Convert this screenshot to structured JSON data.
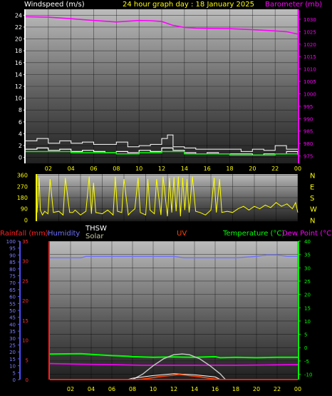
{
  "header": {
    "wind_label": "Windspeed (m/s)",
    "title": "24 hour graph day : 18 January 2025",
    "baro_label": "Barometer (mb)"
  },
  "bottom_header": {
    "rain_label": "Rainfall (mm)",
    "humidity_label": "Humidity",
    "thsw_label": "THSW",
    "solar_label": "Solar",
    "uv_label": "UV",
    "temp_label": "Temperature (°C)",
    "dew_label": "Dew Point (°C)"
  },
  "colors": {
    "wind": "#ffffff",
    "gust": "#ffffff",
    "wind_avg": "#00ff00",
    "barometer": "#ff00ff",
    "direction": "#ffff00",
    "rain": "#ff2020",
    "humidity": "#7070ff",
    "thsw": "#ffffff",
    "solar": "#c8c8c8",
    "uv": "#ff4400",
    "temperature": "#00ff00",
    "dewpoint": "#ff00ff",
    "axis_x": "#ffff00"
  },
  "chart_data": [
    {
      "type": "line",
      "name": "wind-barometer",
      "x_ticks": [
        "02",
        "04",
        "06",
        "08",
        "10",
        "12",
        "14",
        "16",
        "18",
        "20",
        "22",
        "00"
      ],
      "ylim_left": [
        -1,
        25
      ],
      "y_ticks_left": [
        0,
        2,
        4,
        6,
        8,
        10,
        12,
        14,
        16,
        18,
        20,
        22,
        24
      ],
      "ylim_right": [
        972,
        1034
      ],
      "y_ticks_right": [
        975,
        980,
        985,
        990,
        995,
        1000,
        1005,
        1010,
        1015,
        1020,
        1025,
        1030
      ],
      "series": [
        {
          "name": "Barometer",
          "axis": "right",
          "x": [
            0,
            2,
            4,
            6,
            7,
            8,
            9,
            10,
            11,
            12,
            13,
            14,
            15,
            16,
            18,
            20,
            22,
            23,
            24
          ],
          "values": [
            1031,
            1030.8,
            1030.2,
            1029.5,
            1029.2,
            1028.9,
            1029.2,
            1029.5,
            1029.4,
            1029.1,
            1027.5,
            1026.7,
            1026.4,
            1026.3,
            1026.2,
            1025.8,
            1025.3,
            1025,
            1024
          ]
        },
        {
          "name": "Gust",
          "axis": "left",
          "x": [
            0,
            1,
            2,
            3,
            4,
            5,
            6,
            7,
            8,
            9,
            10,
            11,
            12,
            12.5,
            13,
            14,
            15,
            16,
            17,
            18,
            19,
            20,
            21,
            22,
            23,
            24
          ],
          "values": [
            2.8,
            3.2,
            2.4,
            2.8,
            2.4,
            2.6,
            2.2,
            2.2,
            2.6,
            1.8,
            2.0,
            2.2,
            3.2,
            3.8,
            1.8,
            1.6,
            1.4,
            1.4,
            1.4,
            1.4,
            1.0,
            1.4,
            1.2,
            2.0,
            1.4,
            1.4
          ]
        },
        {
          "name": "Wind",
          "axis": "left",
          "x": [
            0,
            1,
            2,
            3,
            4,
            5,
            6,
            7,
            8,
            9,
            10,
            11,
            12,
            13,
            14,
            15,
            16,
            17,
            18,
            19,
            20,
            21,
            22,
            23,
            24
          ],
          "values": [
            1.4,
            1.6,
            1.2,
            1.4,
            1.0,
            1.2,
            1.0,
            0.8,
            1.0,
            0.8,
            1.2,
            1.0,
            1.6,
            1.2,
            0.8,
            0.6,
            0.8,
            0.6,
            0.6,
            0.6,
            0.4,
            0.6,
            0.6,
            1.0,
            0.6
          ]
        },
        {
          "name": "Wind Average",
          "axis": "left",
          "x": [
            0,
            2,
            4,
            6,
            8,
            10,
            12,
            14,
            16,
            18,
            20,
            22,
            24
          ],
          "values": [
            1.0,
            1.0,
            0.8,
            0.8,
            0.6,
            0.8,
            1.0,
            0.6,
            0.6,
            0.4,
            0.4,
            0.6,
            0.4
          ]
        }
      ]
    },
    {
      "type": "line",
      "name": "wind-direction",
      "x_ticks": [
        "02",
        "04",
        "06",
        "08",
        "10",
        "12",
        "14",
        "16",
        "18",
        "20",
        "22",
        "00"
      ],
      "ylim": [
        -10,
        370
      ],
      "y_ticks": [
        0,
        90,
        180,
        270,
        360
      ],
      "compass": [
        "N",
        "W",
        "S",
        "E",
        "N"
      ],
      "series": [
        {
          "name": "Direction",
          "x": [
            0,
            0.2,
            0.3,
            0.5,
            0.7,
            1,
            1.2,
            1.5,
            2,
            2.4,
            2.6,
            3,
            3.3,
            3.5,
            4,
            4.5,
            4.8,
            5,
            5.2,
            5.4,
            6,
            6.5,
            7,
            7.2,
            7.4,
            7.8,
            8,
            8.4,
            8.6,
            9,
            9.3,
            9.5,
            10,
            10.2,
            10.4,
            10.8,
            11,
            11.4,
            11.6,
            12,
            12.2,
            12.4,
            12.6,
            12.8,
            13,
            13.2,
            13.4,
            13.6,
            13.8,
            14,
            14.3,
            14.6,
            15,
            15.5,
            16,
            16.3,
            16.5,
            16.8,
            17,
            17.5,
            18,
            18.5,
            19,
            19.5,
            20,
            20.5,
            21,
            21.5,
            22,
            22.5,
            23,
            23.5,
            23.8,
            24
          ],
          "values": [
            60,
            340,
            80,
            40,
            70,
            50,
            330,
            60,
            70,
            40,
            340,
            60,
            60,
            80,
            40,
            70,
            350,
            50,
            300,
            60,
            50,
            80,
            40,
            350,
            70,
            60,
            330,
            40,
            60,
            90,
            340,
            60,
            40,
            330,
            80,
            50,
            330,
            40,
            350,
            30,
            340,
            60,
            345,
            70,
            350,
            30,
            340,
            80,
            330,
            60,
            350,
            70,
            60,
            40,
            80,
            340,
            60,
            330,
            60,
            70,
            60,
            90,
            110,
            80,
            110,
            90,
            120,
            100,
            140,
            110,
            130,
            90,
            140,
            60
          ]
        }
      ]
    },
    {
      "type": "line",
      "name": "temperature-humidity-solar",
      "x_ticks": [
        "02",
        "04",
        "06",
        "08",
        "10",
        "12",
        "14",
        "16",
        "18",
        "20",
        "22",
        "00"
      ],
      "ylim_humidity": [
        0,
        100
      ],
      "y_ticks_humidity": [
        0,
        5,
        10,
        15,
        20,
        25,
        30,
        35,
        40,
        45,
        50,
        55,
        60,
        65,
        70,
        75,
        80,
        85,
        90,
        95,
        100
      ],
      "ylim_rain": [
        0,
        35
      ],
      "y_ticks_rain": [
        0,
        5,
        10,
        15,
        20,
        25,
        30,
        35
      ],
      "ylim_temp": [
        -12,
        40
      ],
      "y_ticks_temp": [
        -10,
        -5,
        0,
        5,
        10,
        15,
        20,
        25,
        30,
        35,
        40
      ],
      "series": [
        {
          "name": "Humidity",
          "axis": "humidity",
          "x": [
            0,
            3,
            3.5,
            6,
            9,
            12,
            13,
            15,
            18,
            20,
            21,
            22,
            23,
            24
          ],
          "values": [
            88,
            88,
            89,
            89,
            89,
            89,
            88,
            88,
            88,
            89,
            90,
            90,
            89,
            89
          ]
        },
        {
          "name": "Temperature",
          "axis": "temp",
          "x": [
            0,
            3,
            6,
            7.5,
            8,
            10,
            12,
            14,
            16,
            16.5,
            18,
            20,
            22,
            24
          ],
          "values": [
            -2.4,
            -2.3,
            -3.0,
            -3.2,
            -3.4,
            -3.6,
            -3.5,
            -3.6,
            -3.4,
            -3.8,
            -3.6,
            -3.8,
            -3.6,
            -3.6
          ]
        },
        {
          "name": "Dew Point",
          "axis": "temp",
          "x": [
            0,
            3,
            6,
            9,
            12,
            15,
            18,
            21,
            24
          ],
          "values": [
            -6.0,
            -6.2,
            -6.4,
            -6.6,
            -6.6,
            -6.6,
            -6.6,
            -6.5,
            -6.4
          ]
        },
        {
          "name": "Solar",
          "axis": "humidity",
          "x": [
            8,
            9,
            10,
            11,
            12,
            12.8,
            13.5,
            14.5,
            15.5,
            16.5,
            17
          ],
          "values": [
            0,
            4,
            10,
            15,
            18,
            18.5,
            18,
            15,
            10,
            4,
            0
          ]
        },
        {
          "name": "THSW",
          "axis": "temp",
          "x": [
            0,
            7.5,
            8,
            10,
            12,
            14,
            16,
            16.5,
            24
          ],
          "values": [
            -12,
            -12,
            -11.5,
            -10.5,
            -9.8,
            -10.2,
            -11,
            -12,
            -12
          ]
        },
        {
          "name": "UV",
          "axis": "rain",
          "x": [
            0,
            8.5,
            9.5,
            10.5,
            11.5,
            12.5,
            13.5,
            14.5,
            15.5,
            16.5,
            24
          ],
          "values": [
            0,
            0,
            0.3,
            0.7,
            1.0,
            1.3,
            1.0,
            0.7,
            0.3,
            0,
            0
          ]
        },
        {
          "name": "Rainfall",
          "axis": "rain",
          "x": [
            0,
            24
          ],
          "values": [
            0,
            0
          ]
        }
      ]
    }
  ]
}
